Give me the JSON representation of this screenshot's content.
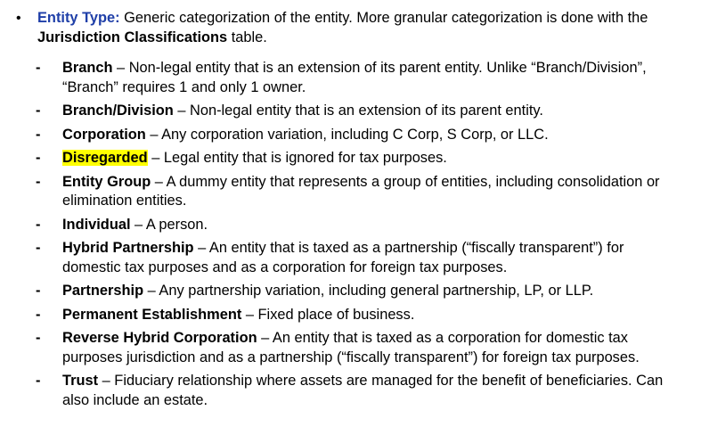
{
  "intro": {
    "bullet": "•",
    "term": "Entity Type:",
    "text_before": " Generic categorization of the entity. More granular categorization is done with the ",
    "link_term": "Jurisdiction Classifications",
    "text_after": " table."
  },
  "items": [
    {
      "dash": "-",
      "term": "Branch",
      "desc": " – Non-legal entity that is an extension of its parent entity. Unlike “Branch/Division”, “Branch” requires 1 and only 1 owner."
    },
    {
      "dash": "-",
      "term": "Branch/Division",
      "desc": " – Non-legal entity that is an extension of its parent entity."
    },
    {
      "dash": "-",
      "term": "Corporation",
      "desc": " – Any corporation variation, including C Corp, S Corp, or LLC."
    },
    {
      "dash": "-",
      "term": "Disregarded",
      "desc": " – Legal entity that is ignored for tax purposes."
    },
    {
      "dash": "-",
      "term": "Entity Group",
      "desc": " – A dummy entity that represents a group of entities, including consolidation or elimination entities."
    },
    {
      "dash": "-",
      "term": "Individual",
      "desc": " – A person."
    },
    {
      "dash": "-",
      "term": "Hybrid Partnership",
      "desc": " – An entity that is taxed as a partnership (“fiscally transparent”) for domestic tax purposes and as a corporation for foreign tax purposes."
    },
    {
      "dash": "-",
      "term": "Partnership",
      "desc": " – Any partnership variation, including general partnership, LP, or LLP."
    },
    {
      "dash": "-",
      "term": "Permanent Establishment",
      "desc": " – Fixed place of business."
    },
    {
      "dash": "-",
      "term": "Reverse Hybrid Corporation",
      "desc": " – An entity that is taxed as a corporation for domestic tax purposes jurisdiction and as a partnership (“fiscally transparent”) for foreign tax purposes."
    },
    {
      "dash": "-",
      "term": "Trust",
      "desc": " – Fiduciary relationship where assets are managed for the benefit of beneficiaries. Can also include an estate."
    }
  ],
  "colors": {
    "term_blue": "#1f3fa8",
    "highlight": "#ffff00"
  }
}
